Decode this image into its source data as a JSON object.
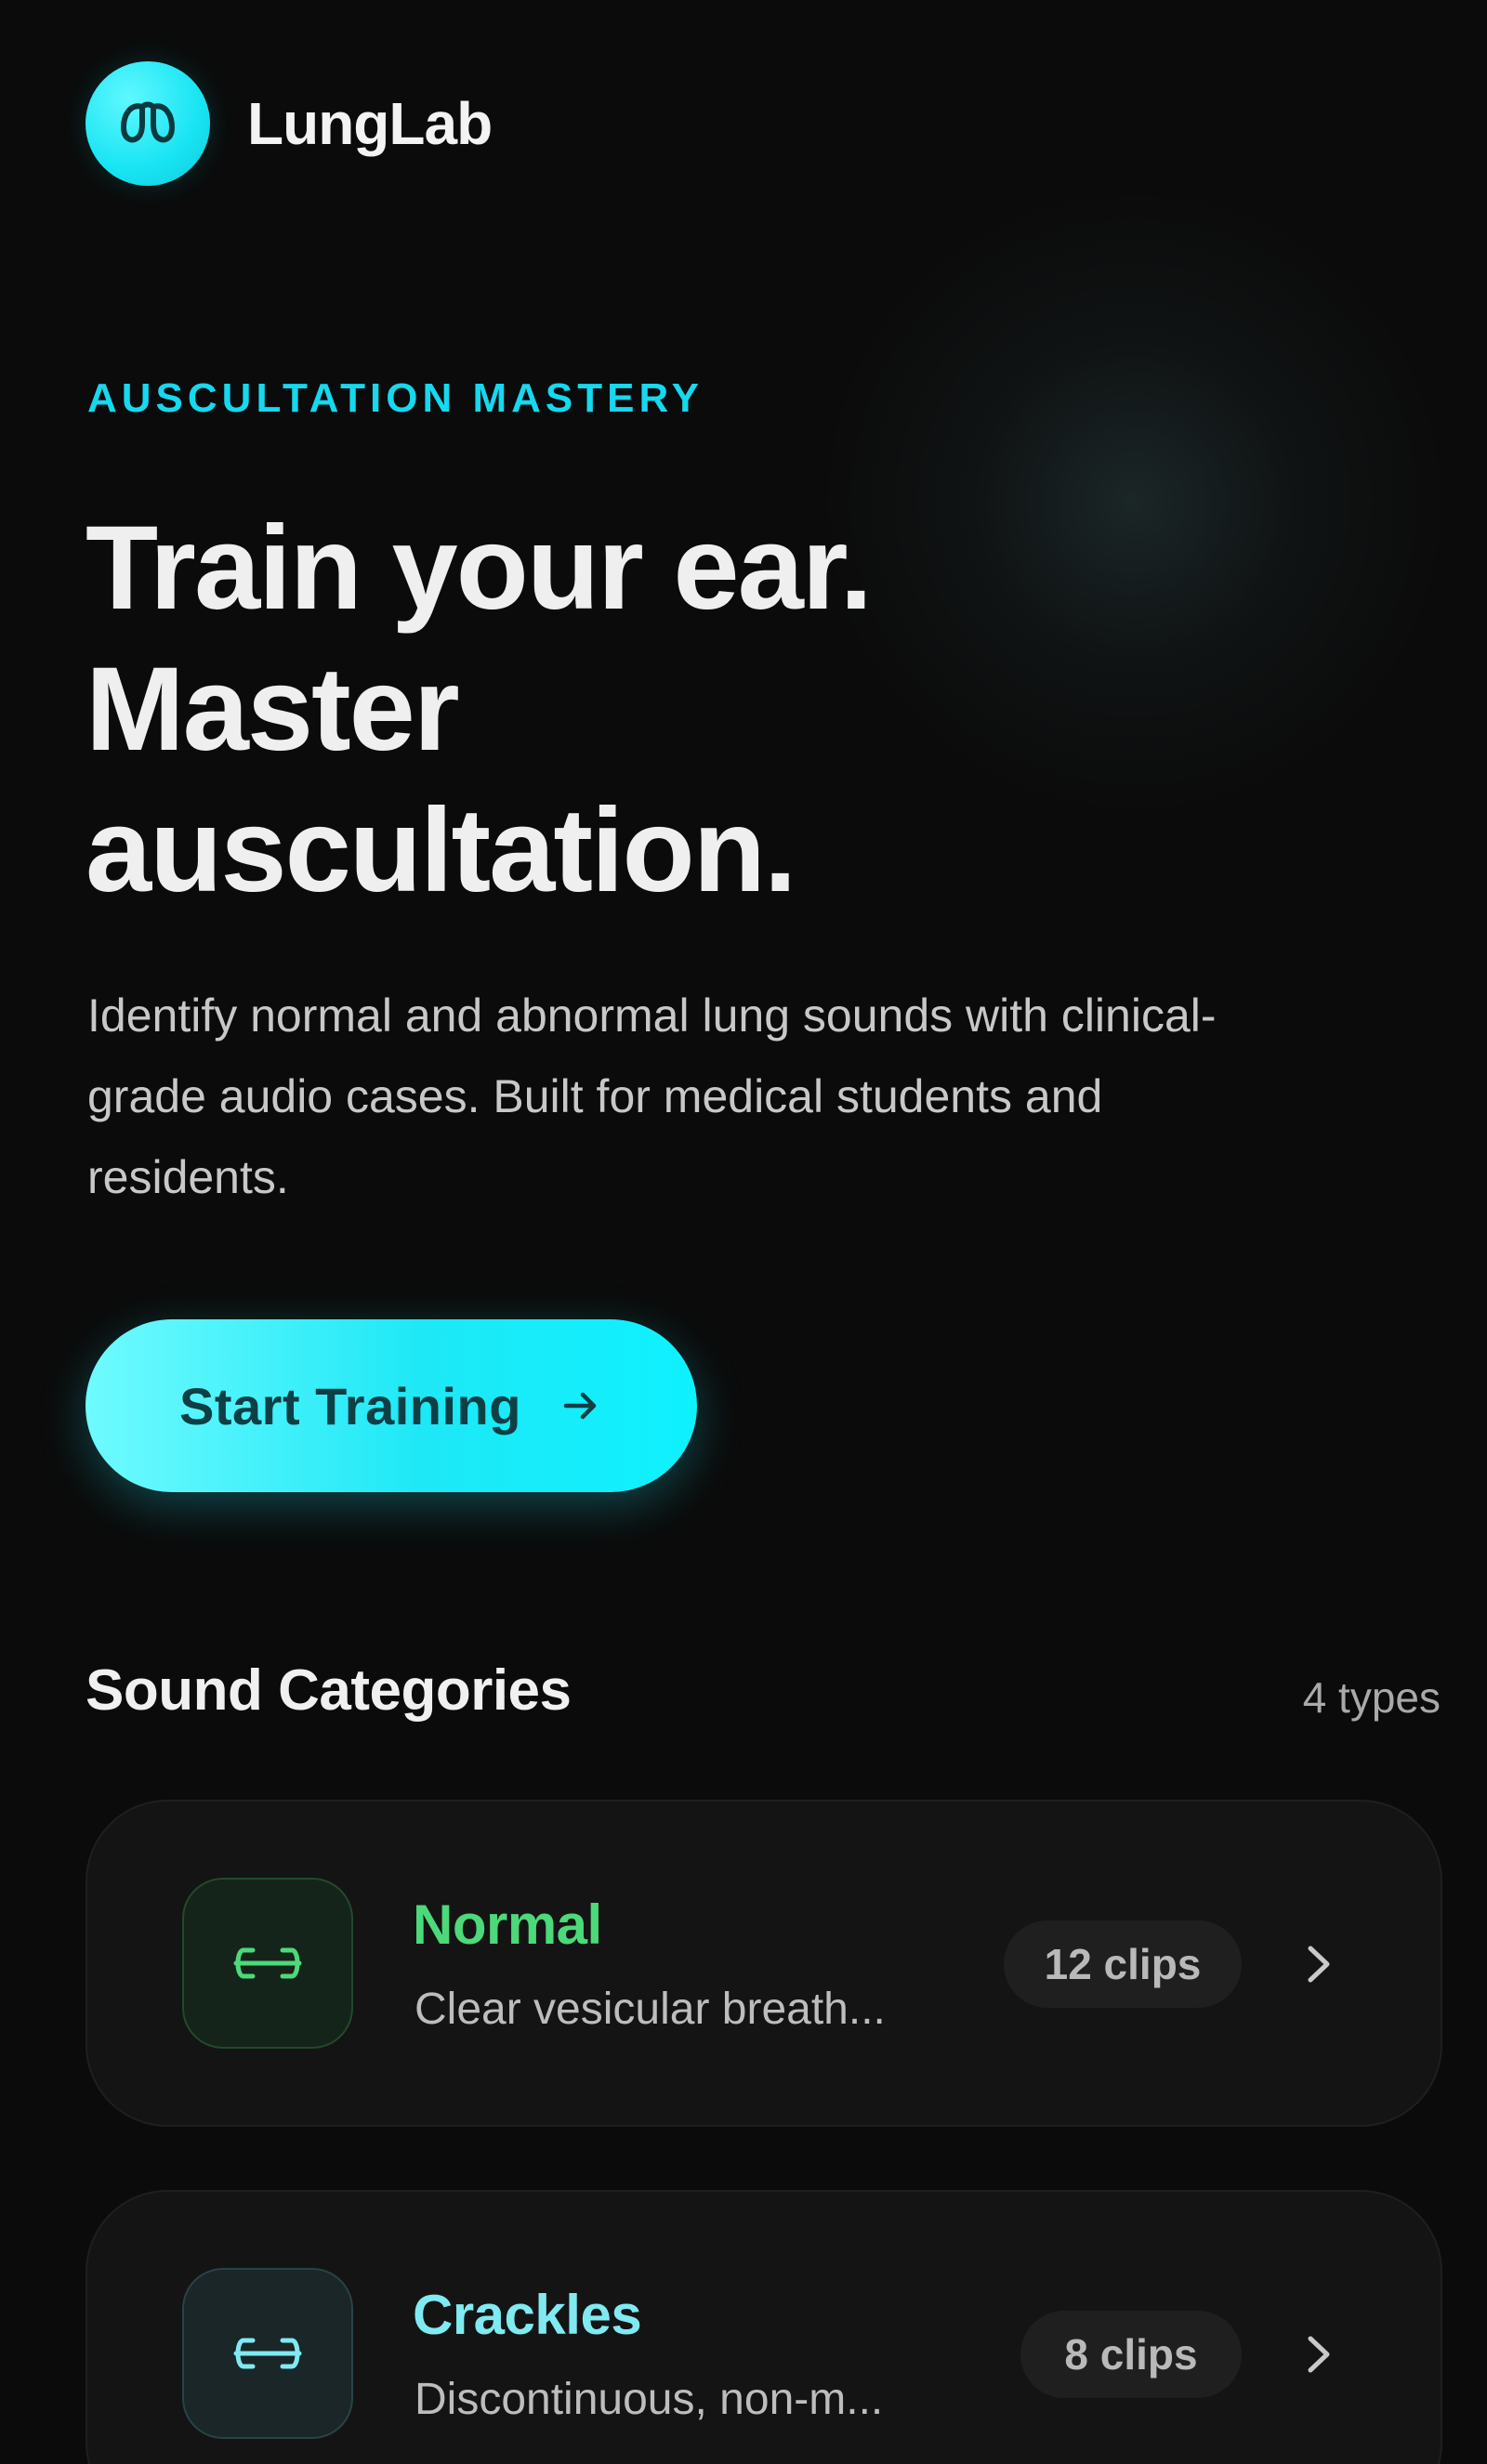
{
  "brand": {
    "name": "LungLab",
    "logo_icon": "lungs-icon",
    "accent_color": "#18e4f3"
  },
  "hero": {
    "eyebrow": "AUSCULTATION MASTERY",
    "headline_lines": [
      "Train your ear.",
      "Master",
      "auscultation."
    ],
    "subtitle": "Identify normal and abnormal lung sounds with clinical-grade audio cases. Built for medical students and residents.",
    "cta_label": "Start Training",
    "cta_icon": "arrow-right-icon"
  },
  "categories": {
    "title": "Sound Categories",
    "count_label": "4 types",
    "items": [
      {
        "name": "Normal",
        "description": "Clear vesicular breath...",
        "badge": "12 clips",
        "icon": "wave-icon",
        "color": "#4cd97a"
      },
      {
        "name": "Crackles",
        "description": "Discontinuous, non-m...",
        "badge": "8 clips",
        "icon": "wave-icon",
        "color": "#7feaf2"
      }
    ]
  }
}
